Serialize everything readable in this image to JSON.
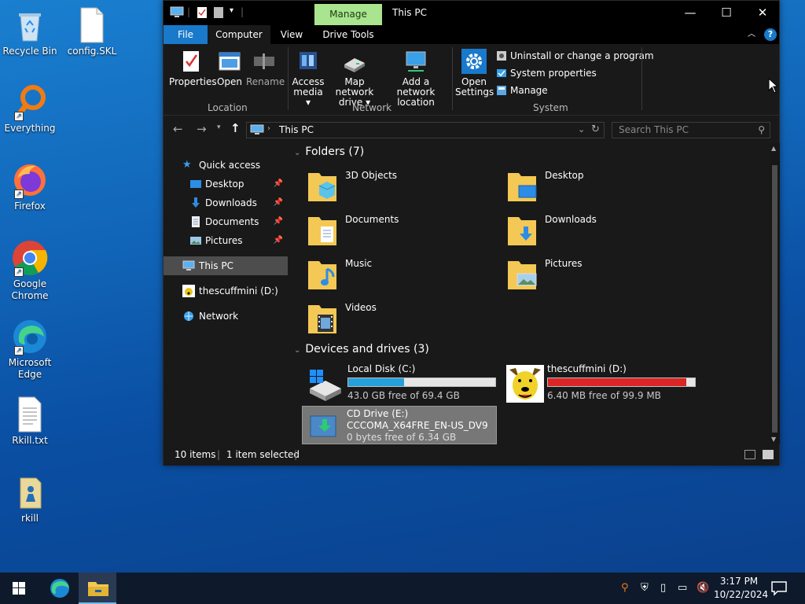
{
  "desktop": {
    "icons": [
      {
        "label": "Recycle Bin",
        "icon": "recycle-bin-icon"
      },
      {
        "label": "config.SKL",
        "icon": "file-icon"
      },
      {
        "label": "Everything",
        "icon": "everything-icon"
      },
      {
        "label": "Firefox",
        "icon": "firefox-icon"
      },
      {
        "label": "Google Chrome",
        "icon": "chrome-icon"
      },
      {
        "label": "Microsoft Edge",
        "icon": "edge-icon"
      },
      {
        "label": "Rkill.txt",
        "icon": "text-file-icon"
      },
      {
        "label": "rkill",
        "icon": "rkill-icon"
      }
    ]
  },
  "window": {
    "title": "This PC",
    "context_tab": "Manage",
    "tabs": [
      "File",
      "Computer",
      "View",
      "Drive Tools"
    ],
    "ribbon": {
      "location": {
        "label": "Location",
        "buttons": [
          "Properties",
          "Open",
          "Rename"
        ]
      },
      "network": {
        "label": "Network",
        "buttons": [
          "Access media",
          "Map network drive",
          "Add a network location"
        ],
        "access_media": [
          "Access",
          "media"
        ],
        "map_drive": [
          "Map network",
          "drive"
        ],
        "add_location": [
          "Add a network",
          "location"
        ]
      },
      "system": {
        "label": "System",
        "open_settings": [
          "Open",
          "Settings"
        ],
        "items": [
          "Uninstall or change a program",
          "System properties",
          "Manage"
        ]
      }
    },
    "address": {
      "path": "This PC",
      "search_placeholder": "Search This PC"
    },
    "nav": {
      "quick_access": "Quick access",
      "pinned": [
        "Desktop",
        "Downloads",
        "Documents",
        "Pictures"
      ],
      "this_pc": "This PC",
      "drive_d": "thescuffmini (D:)",
      "network": "Network"
    },
    "folders_header": "Folders (7)",
    "folders": [
      "3D Objects",
      "Desktop",
      "Documents",
      "Downloads",
      "Music",
      "Pictures",
      "Videos"
    ],
    "drives_header": "Devices and drives (3)",
    "drives": [
      {
        "name": "Local Disk (C:)",
        "free": "43.0 GB free of 69.4 GB",
        "used_fraction": 0.38,
        "color": "#26a0da"
      },
      {
        "name": "thescuffmini (D:)",
        "free": "6.40 MB free of 99.9 MB",
        "used_fraction": 0.94,
        "color": "#da2626"
      },
      {
        "name": "CD Drive (E:)",
        "label": "CCCOMA_X64FRE_EN-US_DV9",
        "free": "0 bytes free of 6.34 GB"
      }
    ],
    "status": {
      "items": "10 items",
      "selected": "1 item selected"
    }
  },
  "taskbar": {
    "time": "3:17 PM",
    "date": "10/22/2024"
  }
}
